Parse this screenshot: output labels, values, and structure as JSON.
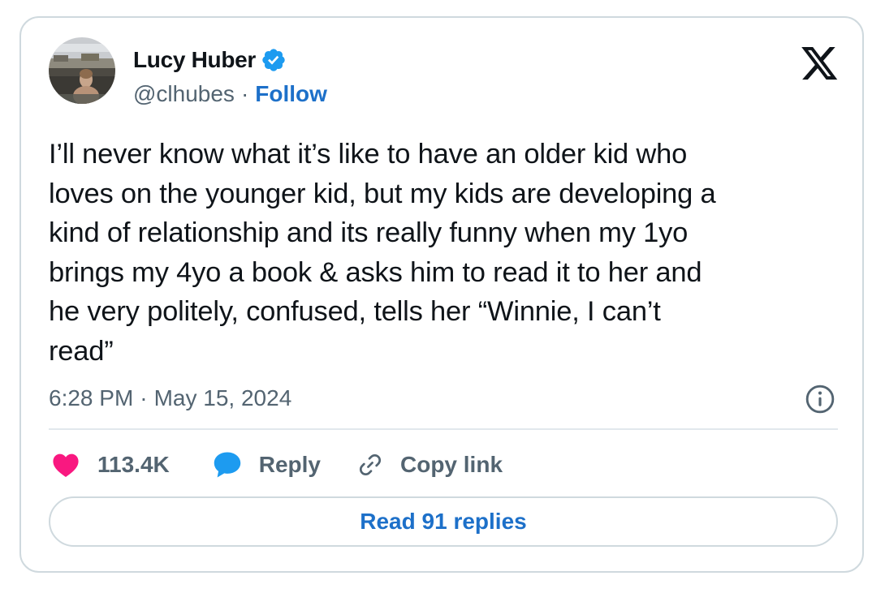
{
  "author": {
    "name": "Lucy Huber",
    "handle": "@clhubes",
    "separator": "·",
    "follow_label": "Follow",
    "verified": true
  },
  "tweet": {
    "text": "I’ll never know what it’s like to have an older kid who\nloves on the younger kid, but my kids are developing a\nkind of relationship and its really funny when my 1yo\nbrings my 4yo a book & asks him to read it to her and\nhe very politely, confused, tells her “Winnie, I can’t\nread”",
    "time": "6:28 PM",
    "separator": "·",
    "date": "May 15, 2024"
  },
  "actions": {
    "likes_count": "113.4K",
    "reply_label": "Reply",
    "copy_link_label": "Copy link"
  },
  "read_replies_label": "Read 91 replies",
  "icons": {
    "logo": "x-logo-icon",
    "verified": "verified-badge-icon",
    "info": "info-icon",
    "like": "heart-icon",
    "reply": "reply-bubble-icon",
    "copy": "link-icon"
  },
  "colors": {
    "accent_blue": "#1d70c9",
    "verified_blue": "#1d9bf0",
    "heart_pink": "#f91880",
    "text_primary": "#0f1419",
    "text_secondary": "#536471",
    "border": "#cfd9de"
  }
}
